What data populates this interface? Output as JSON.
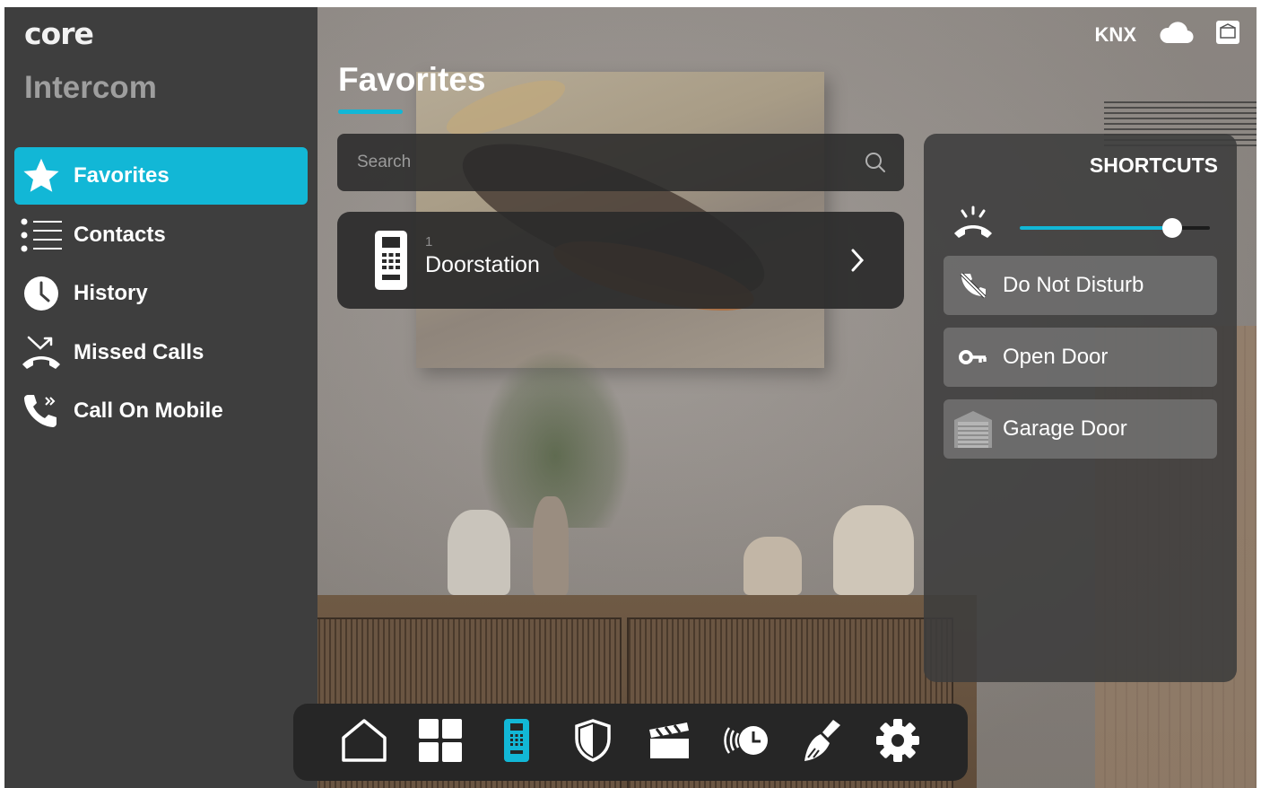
{
  "brand": {
    "logo_text": "core",
    "app_title": "Intercom"
  },
  "status": {
    "protocol": "KNX",
    "cloud_icon": "cloud-icon",
    "device_icon": "tablet-icon"
  },
  "nav": [
    {
      "label": "Favorites",
      "icon": "star-icon",
      "active": true
    },
    {
      "label": "Contacts",
      "icon": "list-icon",
      "active": false
    },
    {
      "label": "History",
      "icon": "clock-icon",
      "active": false
    },
    {
      "label": "Missed Calls",
      "icon": "missed-call-icon",
      "active": false
    },
    {
      "label": "Call On Mobile",
      "icon": "call-forward-icon",
      "active": false
    }
  ],
  "main": {
    "title": "Favorites",
    "search": {
      "placeholder": "Search"
    },
    "favorites": [
      {
        "number": "1",
        "name": "Doorstation",
        "icon": "doorstation-icon"
      }
    ]
  },
  "shortcuts": {
    "title": "SHORTCUTS",
    "ring_volume": 0.8,
    "buttons": [
      {
        "label": "Do Not Disturb",
        "icon": "do-not-disturb-icon"
      },
      {
        "label": "Open Door",
        "icon": "key-icon"
      },
      {
        "label": "Garage Door",
        "icon": "garage-door-icon"
      }
    ]
  },
  "dock": [
    {
      "name": "home",
      "icon": "home-icon",
      "active": false
    },
    {
      "name": "rooms",
      "icon": "grid-icon",
      "active": false
    },
    {
      "name": "intercom",
      "icon": "intercom-icon",
      "active": true
    },
    {
      "name": "security",
      "icon": "shield-icon",
      "active": false
    },
    {
      "name": "scenes",
      "icon": "clapperboard-icon",
      "active": false
    },
    {
      "name": "scheduler",
      "icon": "timer-icon",
      "active": false
    },
    {
      "name": "cleaning",
      "icon": "broom-icon",
      "active": false
    },
    {
      "name": "settings",
      "icon": "gear-icon",
      "active": false
    }
  ],
  "colors": {
    "accent": "#12b7d6",
    "sidebar": "#3e3e3e",
    "panel": "#2a2a2a"
  }
}
